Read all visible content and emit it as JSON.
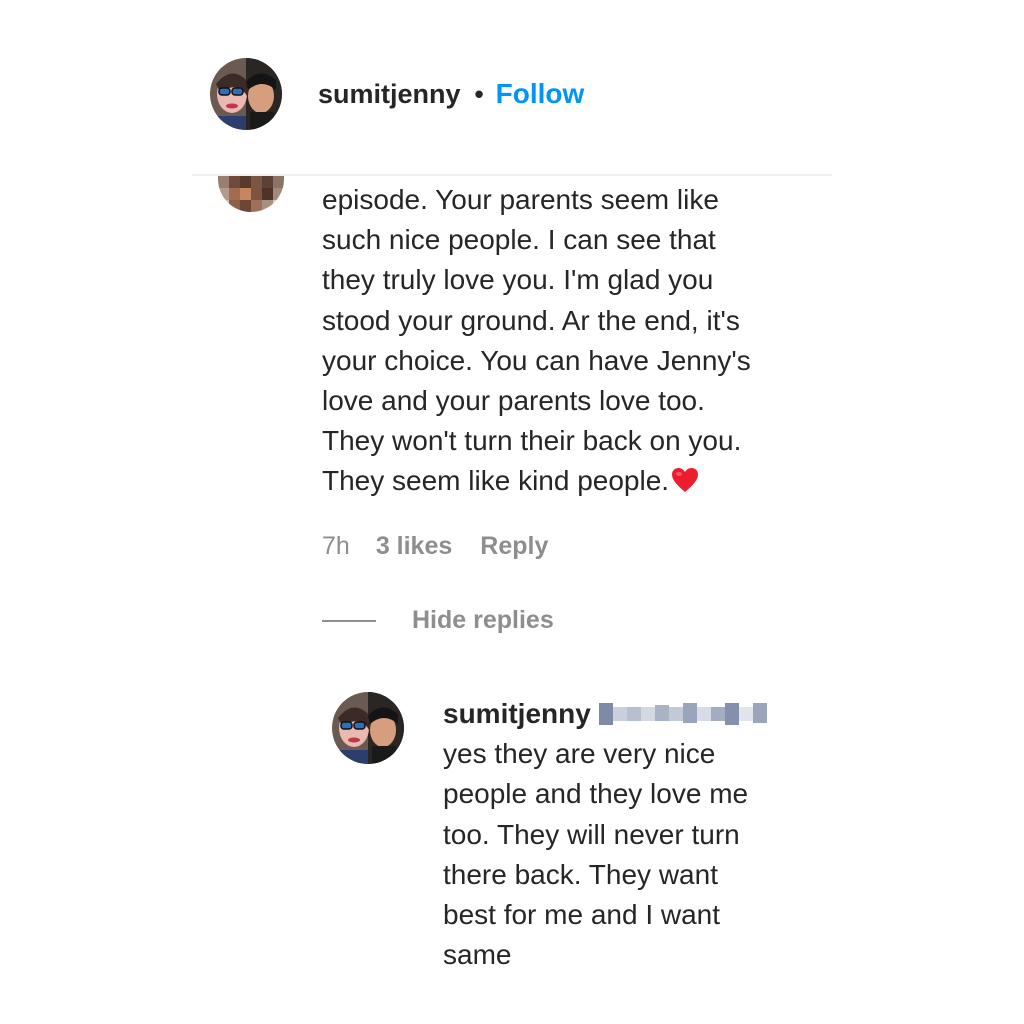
{
  "header": {
    "username": "sumitjenny",
    "separator": "•",
    "follow_label": "Follow"
  },
  "comment": {
    "text": "episode. Your parents seem like\nsuch nice people. I can see that\nthey truly love you. I'm glad you\nstood your ground. Ar the end, it's\nyour choice. You can have Jenny's\nlove and your parents love too.\nThey won't turn their back on you.\nThey seem like kind people.",
    "emoji": "heart-emoji",
    "time": "7h",
    "likes": "3 likes",
    "reply_label": "Reply"
  },
  "replies_toggle": {
    "label": "Hide replies"
  },
  "reply": {
    "username": "sumitjenny",
    "text": "yes they are very nice\npeople and they love me\ntoo. They will never turn\nthere back. They want\nbest for me and I want\nsame"
  },
  "colors": {
    "follow": "#0095f6",
    "text": "#262626",
    "muted": "#8e8e8e",
    "heart": "#ed1c2e"
  }
}
